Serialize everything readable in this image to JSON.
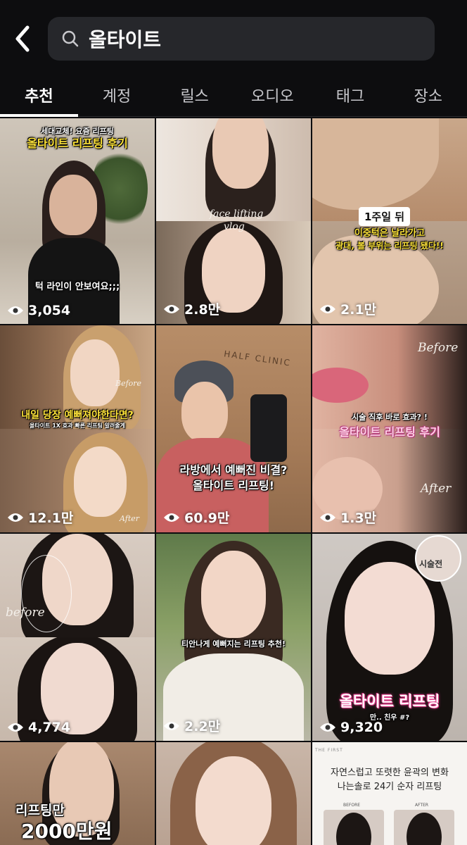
{
  "search": {
    "query": "올타이트"
  },
  "tabs": [
    "추천",
    "계정",
    "릴스",
    "오디오",
    "태그",
    "장소"
  ],
  "tiles": {
    "t1": {
      "caption_small": "세대교체! 요즘 리프팅",
      "caption_title": "올타이트 리프팅 후기",
      "caption_sub": "턱 라인이 안보여요;;;",
      "views": "3,054"
    },
    "t2": {
      "script1": "face lifting",
      "script2": "vlog",
      "views": "2.8만"
    },
    "t3": {
      "badge": "1주일 뒤",
      "caption_line1": "이중턱은 날라가고",
      "caption_line2": "광대, 볼 부위는 리프팅 됐다!!",
      "views": "2.1만"
    },
    "t4": {
      "label_before": "Before",
      "caption_title": "내일 당장 예뻐져야한다면?",
      "caption_sub": "올타이트 1X 효과 빠른 리프팅 알려줄게",
      "label_after": "After",
      "views": "12.1만"
    },
    "t5": {
      "sign": "HALF CLINIC",
      "caption_line1": "라방에서 예뻐진 비결?",
      "caption_line2": "올타이트 리프팅!",
      "views": "60.9만"
    },
    "t6": {
      "label_before": "Before",
      "caption_small": "시술 직후 바로 효과? !",
      "caption_title": "올타이트 리프팅 후기",
      "label_after": "After",
      "views": "1.3만"
    },
    "t7": {
      "label_before": "before",
      "views": "4,774"
    },
    "t8": {
      "caption": "티안나게 예뻐지는 리프팅 추천!",
      "views": "2.2만"
    },
    "t9": {
      "label_before": "시술전",
      "caption_title": "올타이트 리프팅",
      "caption_sub": "만.. 친우 #?",
      "views": "9,320"
    },
    "t10": {
      "caption_line1": "리프팅만",
      "caption_line2": "2000만원"
    },
    "t12": {
      "brand": "THE FIRST",
      "line1": "자연스럽고 또렷한 윤곽의 변화",
      "line2": "나는솔로 24기 순자 리프팅",
      "before": "BEFORE",
      "after": "AFTER"
    }
  },
  "colors": {
    "bg": "#0d0d0f",
    "search_bg": "#26272b",
    "caption_yellow": "#ffe43a"
  }
}
